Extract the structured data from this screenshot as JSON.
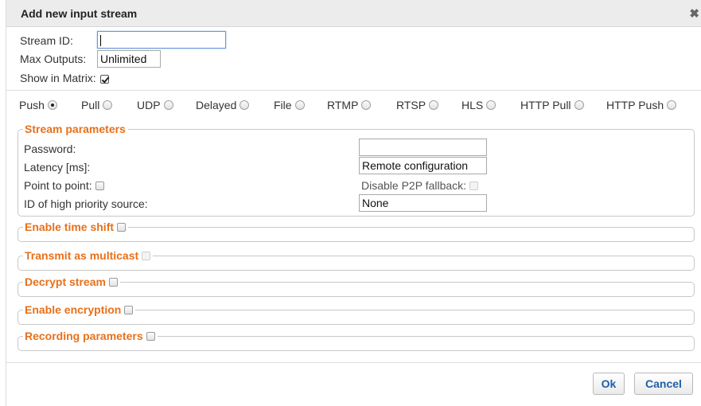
{
  "dialog": {
    "title": "Add new input stream",
    "close_glyph": "✖"
  },
  "form": {
    "stream_id_label": "Stream ID:",
    "stream_id_value": "",
    "max_outputs_label": "Max Outputs:",
    "max_outputs_value": "Unlimited",
    "show_in_matrix_label": "Show in Matrix:",
    "show_in_matrix_checked": true
  },
  "stream_types": [
    {
      "label": "Push",
      "selected": true
    },
    {
      "label": "Pull",
      "selected": false
    },
    {
      "label": "UDP",
      "selected": false
    },
    {
      "label": "Delayed",
      "selected": false
    },
    {
      "label": "File",
      "selected": false
    },
    {
      "label": "RTMP",
      "selected": false
    },
    {
      "label": "RTSP",
      "selected": false
    },
    {
      "label": "HLS",
      "selected": false
    },
    {
      "label": "HTTP Pull",
      "selected": false
    },
    {
      "label": "HTTP Push",
      "selected": false
    }
  ],
  "stream_parameters": {
    "legend": "Stream parameters",
    "password_label": "Password:",
    "password_value": "",
    "latency_label": "Latency [ms]:",
    "latency_value": "Remote configuration",
    "point_to_point_label": "Point to point:",
    "disable_p2p_label": "Disable P2P fallback:",
    "priority_source_label": "ID of high priority source:",
    "priority_source_value": "None"
  },
  "sections": {
    "time_shift": "Enable time shift",
    "multicast": "Transmit as multicast",
    "decrypt": "Decrypt stream",
    "encryption": "Enable encryption",
    "recording": "Recording parameters"
  },
  "buttons": {
    "ok": "Ok",
    "cancel": "Cancel"
  },
  "colors": {
    "legend_orange": "#e8701a",
    "button_blue": "#1f5fa9"
  }
}
